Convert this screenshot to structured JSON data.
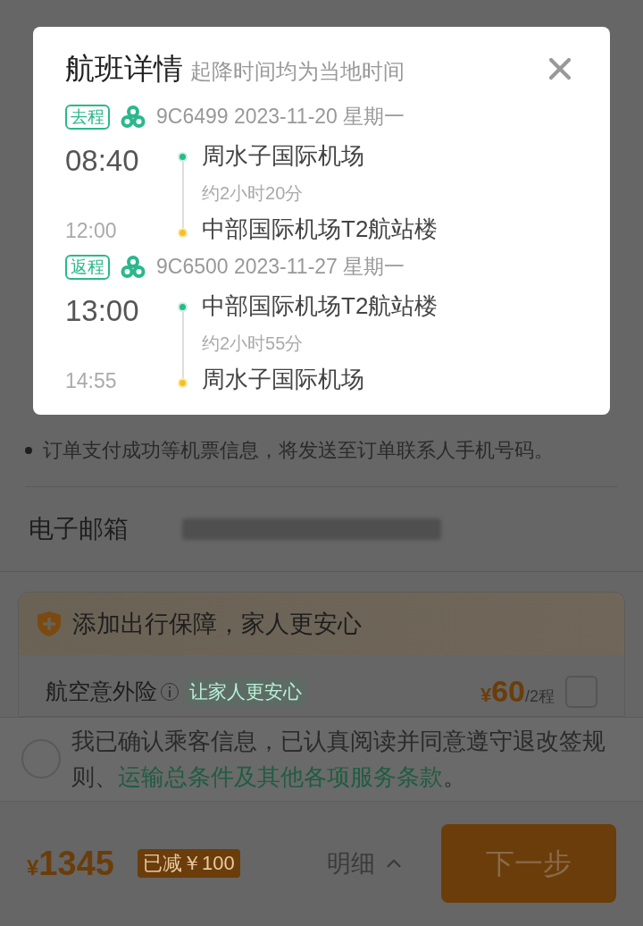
{
  "dialog": {
    "title": "航班详情",
    "subtitle": "起降时间均为当地时间",
    "legs": [
      {
        "tag": "去程",
        "flight": "9C6499 2023-11-20 星期一",
        "depart_time": "08:40",
        "depart_airport": "周水子国际机场",
        "duration": "约2小时20分",
        "arrive_time": "12:00",
        "arrive_airport": "中部国际机场T2航站楼"
      },
      {
        "tag": "返程",
        "flight": "9C6500 2023-11-27 星期一",
        "depart_time": "13:00",
        "depart_airport": "中部国际机场T2航站楼",
        "duration": "约2小时55分",
        "arrive_time": "14:55",
        "arrive_airport": "周水子国际机场"
      }
    ]
  },
  "notice": "订单支付成功等机票信息，将发送至订单联系人手机号码。",
  "email": {
    "label": "电子邮箱"
  },
  "insurance": {
    "title": "添加出行保障，家人更安心",
    "items": [
      {
        "name": "航空意外险",
        "tag": "让家人更安心",
        "currency": "¥",
        "price": "60",
        "unit": "/2程",
        "checked": false
      }
    ]
  },
  "agreement": {
    "checked": false,
    "text": "我已确认乘客信息，已认真阅读并同意遵守退改签规则、",
    "link": "运输总条件及其他各项服务条款",
    "suffix": "。"
  },
  "footer": {
    "currency": "¥",
    "total": "1345",
    "discount": "已减￥100",
    "detail": "明细",
    "next": "下一步"
  }
}
